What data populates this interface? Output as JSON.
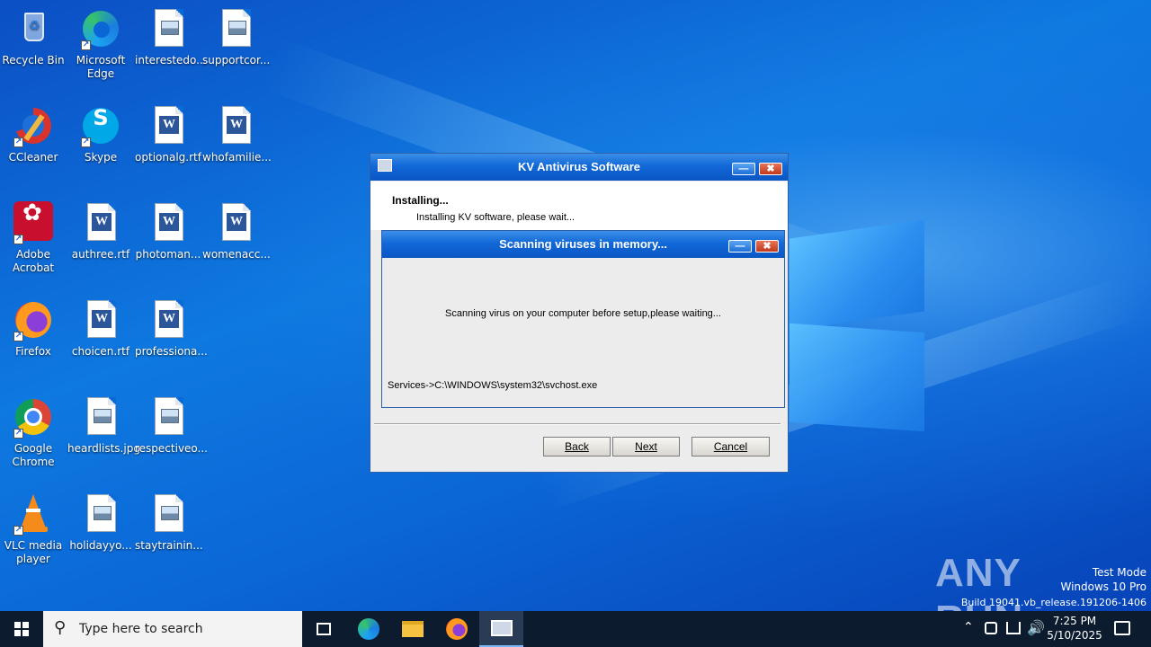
{
  "desktop": {
    "icons": [
      {
        "label": "Recycle Bin",
        "icon": "recycle-bin-icon"
      },
      {
        "label": "Microsoft Edge",
        "icon": "edge-icon"
      },
      {
        "label": "interestedo...",
        "icon": "image-file-icon"
      },
      {
        "label": "supportcor...",
        "icon": "image-file-icon"
      },
      {
        "label": "CCleaner",
        "icon": "ccleaner-icon"
      },
      {
        "label": "Skype",
        "icon": "skype-icon"
      },
      {
        "label": "optionalg.rtf",
        "icon": "word-doc-icon"
      },
      {
        "label": "whofamilie...",
        "icon": "word-doc-icon"
      },
      {
        "label": "Adobe Acrobat",
        "icon": "acrobat-icon"
      },
      {
        "label": "authree.rtf",
        "icon": "word-doc-icon"
      },
      {
        "label": "photoman...",
        "icon": "word-doc-icon"
      },
      {
        "label": "womenacc...",
        "icon": "word-doc-icon"
      },
      {
        "label": "Firefox",
        "icon": "firefox-icon"
      },
      {
        "label": "choicen.rtf",
        "icon": "word-doc-icon"
      },
      {
        "label": "professiona...",
        "icon": "word-doc-icon"
      },
      {
        "label": "Google Chrome",
        "icon": "chrome-icon"
      },
      {
        "label": "heardlists.jpg",
        "icon": "image-file-icon"
      },
      {
        "label": "respectiveo...",
        "icon": "image-file-icon"
      },
      {
        "label": "VLC media player",
        "icon": "vlc-icon"
      },
      {
        "label": "holidayyo...",
        "icon": "image-file-icon"
      },
      {
        "label": "staytrainin...",
        "icon": "image-file-icon"
      }
    ]
  },
  "installer": {
    "title": "KV Antivirus Software",
    "heading": "Installing...",
    "subheading": "Installing KV software, please wait...",
    "min_label": "—",
    "close_label": "✖",
    "buttons": {
      "back": "Back",
      "next": "Next",
      "cancel": "Cancel"
    }
  },
  "scan": {
    "title": "Scanning viruses in memory...",
    "message": "Scanning virus on your computer before setup,please waiting...",
    "status": "Services->C:\\WINDOWS\\system32\\svchost.exe",
    "min_label": "—",
    "close_label": "✖"
  },
  "watermark": {
    "brand": "ANY RUN",
    "line1": "Test Mode",
    "line2": "Windows 10 Pro",
    "line3": "Build 19041.vb_release.191206-1406"
  },
  "taskbar": {
    "search_placeholder": "Type here to search",
    "time": "7:25 PM",
    "date": "5/10/2025"
  },
  "colors": {
    "titlebar": "#1268d8",
    "taskbar": "#0d1b2e",
    "dialog_bg": "#d4d0c8"
  }
}
